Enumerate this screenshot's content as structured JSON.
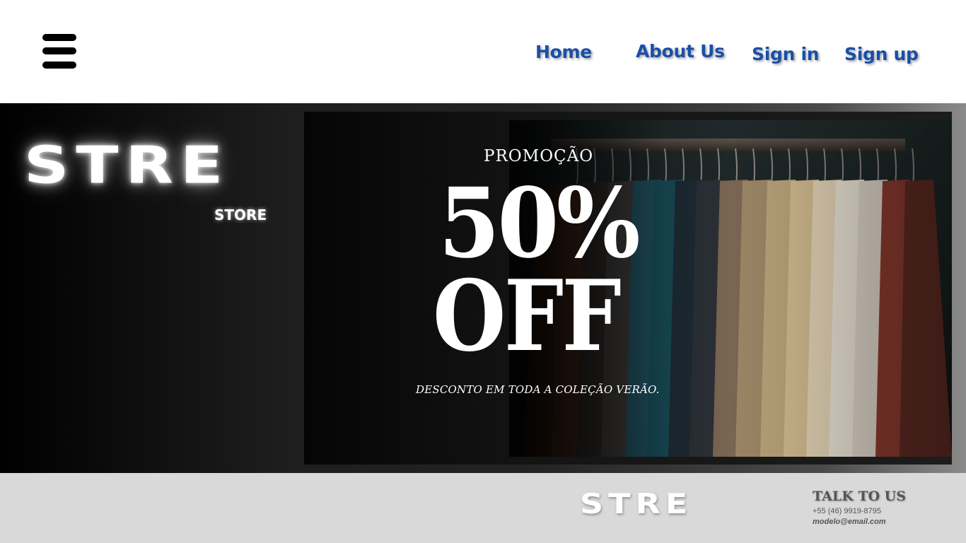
{
  "header": {
    "menu_icon": "hamburger-menu-icon",
    "nav": {
      "home": "Home",
      "about": "About Us",
      "signin": "Sign in",
      "signup": "Sign up"
    },
    "nav_color": "#1a4fa8"
  },
  "hero": {
    "brand": "STRE",
    "brand_sub": "STORE",
    "banner": {
      "label": "PROMOÇÃO",
      "percent": "50%",
      "off": "OFF",
      "subtitle": "DESCONTO EM TODA A COLEÇÃO VERÃO."
    }
  },
  "footer": {
    "brand": "STRE",
    "contact": {
      "title": "TALK TO US",
      "phone": "+55 (46) 9919-8795",
      "email": "modelo@email.com"
    }
  }
}
